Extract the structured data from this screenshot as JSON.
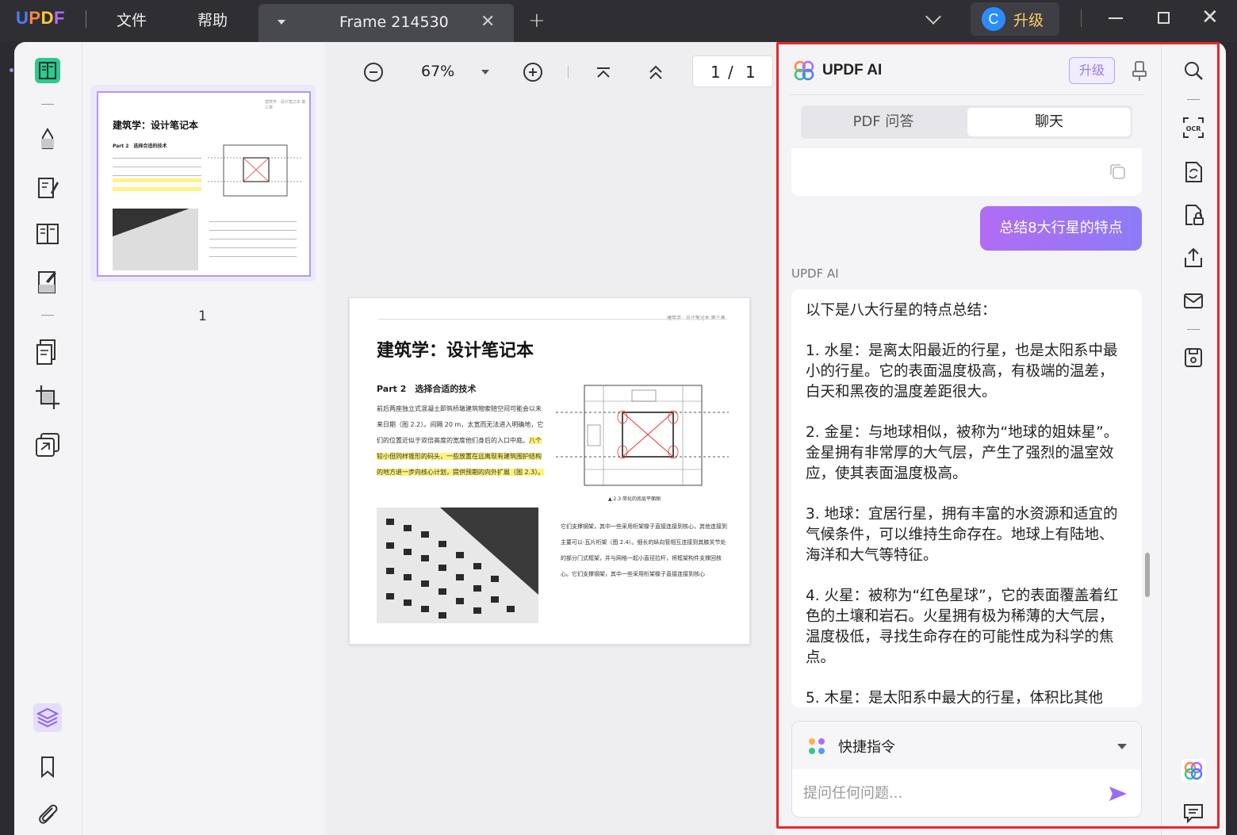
{
  "app": {
    "logo": "UPDF"
  },
  "menu": {
    "file": "文件",
    "help": "帮助"
  },
  "tab": {
    "title": "Frame 214530"
  },
  "titlebar": {
    "upgrade_avatar": "C",
    "upgrade_label": "升级"
  },
  "colors": {
    "accent": "#9b7bf0",
    "highlight_box": "#e8262a",
    "bubble_gradient_start": "#b16cf4",
    "bubble_gradient_end": "#8d7bf5",
    "text_highlight": "#fff27a"
  },
  "toolbar": {
    "zoom": "67%",
    "page_current": "1",
    "page_sep": "/",
    "page_total": "1"
  },
  "thumbnail": {
    "page_number": "1"
  },
  "document": {
    "header": "建筑学 · 设计笔记本 第三章",
    "title": "建筑学：设计笔记本",
    "part": "Part 2　选择合适的技术",
    "para1": "前后两座独立式混凝土即筑桥墩建筑物索赔空间可能会以未来日期（图 2.2）。间隔 20 m，太宽而无法进入明确地，它们的位置近似于双倍高度的宽度他们身后的入口中庭。",
    "para1_highlight": "八个较小但同样锥形的码头，一些放置在远离现有建筑围护结构的地方退一步向核心计划，提供预期的向外扩展（图 2.3）。",
    "caption": "▲ 2.3  简化的底层平面图",
    "para2": "它们支撑钢架，其中一些采用桁架椽子直接连接到核心，其他连接到主要可以-瓦片桁架（图 2.4）。细长的纵向管相互连接到其膝关节处的部分门式框架，并与网格一起小直径拉杆，将框架构件支撑回核心。它们支撑钢架，其中一些采用桁架椽子直接连接到核心"
  },
  "ai": {
    "title": "UPDF AI",
    "upgrade": "升级",
    "tabs": {
      "pdf_qa": "PDF 问答",
      "chat": "聊天"
    },
    "user_message": "总结8大行星的特点",
    "sender_label": "UPDF AI",
    "answer": [
      "以下是八大行星的特点总结：",
      "1. 水星：是离太阳最近的行星，也是太阳系中最小的行星。它的表面温度极高，有极端的温差，白天和黑夜的温度差距很大。",
      "2. 金星：与地球相似，被称为“地球的姐妹星”。金星拥有非常厚的大气层，产生了强烈的温室效应，使其表面温度极高。",
      "3. 地球：宜居行星，拥有丰富的水资源和适宜的气候条件，可以维持生命存在。地球上有陆地、海洋和大气等特征。",
      "4. 火星：被称为“红色星球”，它的表面覆盖着红色的土壤和岩石。火星拥有极为稀薄的大气层，温度极低，寻找生命存在的可能性成为科学的焦点。",
      "5. 木星：是太阳系中最大的行星，体积比其他"
    ],
    "quick_commands": "快捷指令",
    "input_placeholder": "提问任何问题..."
  }
}
